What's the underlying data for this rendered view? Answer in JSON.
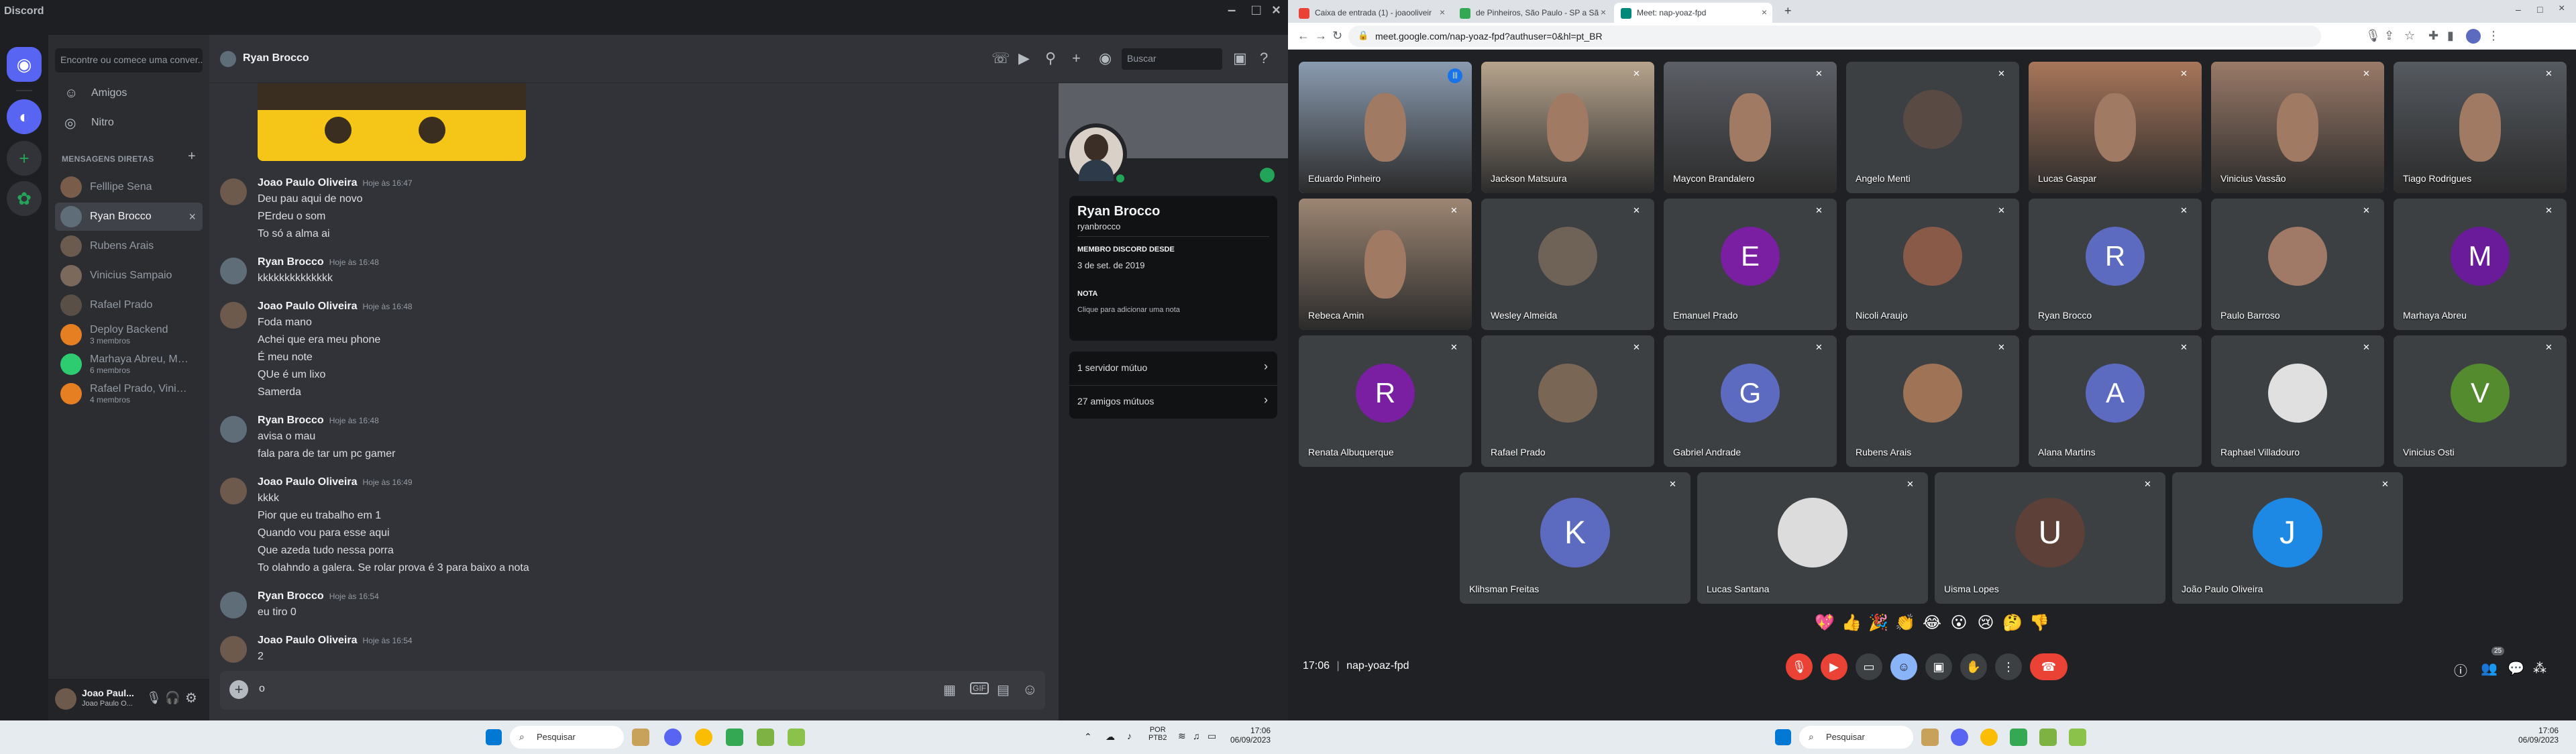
{
  "discord": {
    "app_title": "Discord",
    "search_placeholder": "Encontre ou comece uma conver...",
    "nav": [
      {
        "label": "Amigos",
        "icon": "friends-icon"
      },
      {
        "label": "Nitro",
        "icon": "nitro-icon"
      }
    ],
    "dm_header": "MENSAGENS DIRETAS",
    "dms": [
      {
        "name": "Felllipe Sena",
        "sub": "",
        "color": "#7a5c4a"
      },
      {
        "name": "Ryan Brocco",
        "sub": "",
        "color": "#5f6d78",
        "active": true
      },
      {
        "name": "Rubens Arais",
        "sub": "",
        "color": "#6b5b4e"
      },
      {
        "name": "Vinicius Sampaio",
        "sub": "",
        "color": "#7b6a5c"
      },
      {
        "name": "Rafael Prado",
        "sub": "",
        "color": "#5a4f46"
      },
      {
        "name": "Deploy Backend",
        "sub": "3 membros",
        "color": "#e67e22"
      },
      {
        "name": "Marhaya Abreu, Math...",
        "sub": "6 membros",
        "color": "#2ecc71"
      },
      {
        "name": "Rafael Prado, Vinicius...",
        "sub": "4 membros",
        "color": "#e67e22"
      }
    ],
    "user": {
      "name": "Joao Paul...",
      "sub": "Joao Paulo O..."
    },
    "chat_header": {
      "name": "Ryan Brocco",
      "search": "Buscar"
    },
    "messages": [
      {
        "author": "Joao Paulo Oliveira",
        "ts": "Hoje às 16:47",
        "lines": [
          "Deu pau aqui de novo",
          "PErdeu o som",
          "To só a alma ai"
        ]
      },
      {
        "author": "Ryan Brocco",
        "ts": "Hoje às 16:48",
        "lines": [
          "kkkkkkkkkkkkkk"
        ]
      },
      {
        "author": "Joao Paulo Oliveira",
        "ts": "Hoje às 16:48",
        "lines": [
          "Foda mano",
          "Achei que era meu phone",
          "É meu note",
          "QUe é um lixo",
          "Samerda"
        ]
      },
      {
        "author": "Ryan Brocco",
        "ts": "Hoje às 16:48",
        "lines": [
          "avisa o mau",
          "fala para de tar um pc gamer"
        ]
      },
      {
        "author": "Joao Paulo Oliveira",
        "ts": "Hoje às 16:49",
        "lines": [
          "kkkk",
          "Pior que eu trabalho em 1",
          "Quando vou para esse aqui",
          "Que azeda tudo nessa porra",
          "To olahndo a galera. Se rolar prova é 3 para baixo a nota"
        ]
      },
      {
        "author": "Ryan Brocco",
        "ts": "Hoje às 16:54",
        "lines": [
          "eu tiro 0"
        ]
      },
      {
        "author": "Joao Paulo Oliveira",
        "ts": "Hoje às 16:54",
        "lines": [
          "2"
        ]
      }
    ],
    "input_value": "o",
    "profile": {
      "display_name": "Ryan Brocco",
      "username": "ryanbrocco",
      "member_since_label": "MEMBRO DISCORD DESDE",
      "member_since": "3 de set. de 2019",
      "note_label": "NOTA",
      "note_placeholder": "Clique para adicionar uma nota",
      "mutual_servers": "1 servidor mútuo",
      "mutual_friends": "27 amigos mútuos"
    }
  },
  "taskbar_left": {
    "search": "Pesquisar",
    "lang": "POR",
    "layout": "PTB2",
    "time": "17:06",
    "date": "06/09/2023"
  },
  "taskbar_right": {
    "search": "Pesquisar",
    "time": "17:06",
    "date": "06/09/2023"
  },
  "chrome": {
    "tabs": [
      {
        "title": "Caixa de entrada (1) - joaooliveir",
        "fav_color": "#ea4335"
      },
      {
        "title": "de Pinheiros, São Paulo - SP a Sã",
        "fav_color": "#34a853"
      },
      {
        "title": "Meet: nap-yoaz-fpd",
        "fav_color": "#00897b",
        "active": true
      }
    ],
    "url": "meet.google.com/nap-yoaz-fpd?authuser=0&hl=pt_BR"
  },
  "meet": {
    "participants": [
      {
        "name": "Eduardo Pinheiro",
        "video": true,
        "speaking": true,
        "color": "#8a9bb0"
      },
      {
        "name": "Jackson Matsuura",
        "video": true,
        "color": "#b7a48d"
      },
      {
        "name": "Maycon Brandalero",
        "video": true,
        "color": "#5c5f66"
      },
      {
        "name": "Angelo Menti",
        "photo": true,
        "color": "#5a4a44"
      },
      {
        "name": "Lucas Gaspar",
        "video": true,
        "color": "#a8765a"
      },
      {
        "name": "Vinicius Vassão",
        "video": true,
        "color": "#9a7a68"
      },
      {
        "name": "Tiago Rodrigues",
        "video": true,
        "color": "#555a60"
      },
      {
        "name": "Rebeca Amin",
        "video": true,
        "color": "#9c8572"
      },
      {
        "name": "Wesley Almeida",
        "photo": true,
        "color": "#6f6256"
      },
      {
        "name": "Emanuel Prado",
        "initial": "E",
        "color": "#7b1fa2"
      },
      {
        "name": "Nicoli Araujo",
        "photo": true,
        "color": "#8a5a48"
      },
      {
        "name": "Ryan Brocco",
        "initial": "R",
        "color": "#5c6bc0"
      },
      {
        "name": "Paulo Barroso",
        "photo": true,
        "color": "#a07a66"
      },
      {
        "name": "Marhaya Abreu",
        "initial": "M",
        "color": "#6a1b9a"
      },
      {
        "name": "Renata Albuquerque",
        "initial": "R",
        "color": "#7b1fa2"
      },
      {
        "name": "Rafael Prado",
        "photo": true,
        "color": "#7a6654"
      },
      {
        "name": "Gabriel Andrade",
        "initial": "G",
        "color": "#5c6bc0"
      },
      {
        "name": "Rubens Arais",
        "photo": true,
        "color": "#9e7356"
      },
      {
        "name": "Alana Martins",
        "initial": "A",
        "color": "#5c6bc0"
      },
      {
        "name": "Raphael Villadouro",
        "photo": true,
        "color": "#e0e0e0"
      },
      {
        "name": "Vinicius Osti",
        "initial": "V",
        "color": "#558b2f"
      },
      {
        "name": "Klihsman Freitas",
        "initial": "K",
        "color": "#5c6bc0"
      },
      {
        "name": "Lucas Santana",
        "photo": true,
        "color": "#dcdcdc"
      },
      {
        "name": "Uisma Lopes",
        "initial": "U",
        "color": "#5d4037"
      },
      {
        "name": "João Paulo Oliveira",
        "initial": "J",
        "color": "#1e88e5"
      }
    ],
    "reactions": [
      "💖",
      "👍",
      "🎉",
      "👏",
      "😂",
      "😮",
      "😢",
      "🤔",
      "👎"
    ],
    "time": "17:06",
    "meeting_code": "nap-yoaz-fpd",
    "participant_count": "25"
  }
}
